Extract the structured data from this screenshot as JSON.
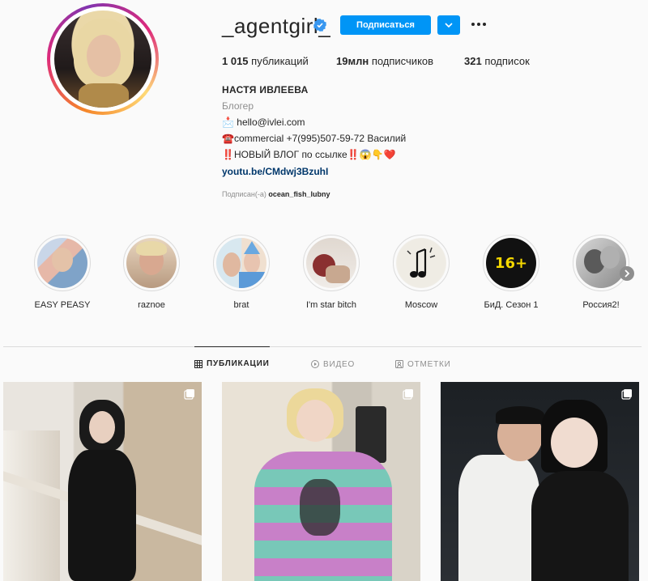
{
  "profile": {
    "username": "_agentgirl_",
    "follow_label": "Подписаться",
    "stats": {
      "posts_count": "1 015",
      "posts_label": "публикаций",
      "followers_count": "19млн",
      "followers_label": "подписчиков",
      "following_count": "321",
      "following_label": "подписок"
    },
    "full_name": "НАСТЯ ИВЛЕЕВА",
    "category": "Блогер",
    "bio": [
      "📩 hello@ivlei.com",
      "☎️commercial +7(995)507-59-72 Василий",
      "‼️НОВЫЙ ВЛОГ по ссылке‼️😱👇❤️"
    ],
    "link": "youtu.be/CMdwj3BzuhI",
    "followed_by_prefix": "Подписан(-а)",
    "followed_by_user": "ocean_fish_lubny"
  },
  "highlights": [
    {
      "label": "EASY PEASY"
    },
    {
      "label": "raznoe"
    },
    {
      "label": "brat"
    },
    {
      "label": "I'm star bitch"
    },
    {
      "label": "Moscow"
    },
    {
      "label": "БиД. Сезон 1",
      "cover_text": "16+"
    },
    {
      "label": "Россия2!"
    }
  ],
  "tabs": [
    {
      "label": "ПУБЛИКАЦИИ",
      "icon": "grid-icon",
      "active": true
    },
    {
      "label": "ВИДЕО",
      "icon": "video-icon",
      "active": false
    },
    {
      "label": "ОТМЕТКИ",
      "icon": "tag-icon",
      "active": false
    }
  ],
  "colors": {
    "accent": "#0095f6",
    "link": "#00376b",
    "muted": "#8e8e8e",
    "border": "#dbdbdb",
    "background": "#fafafa"
  }
}
